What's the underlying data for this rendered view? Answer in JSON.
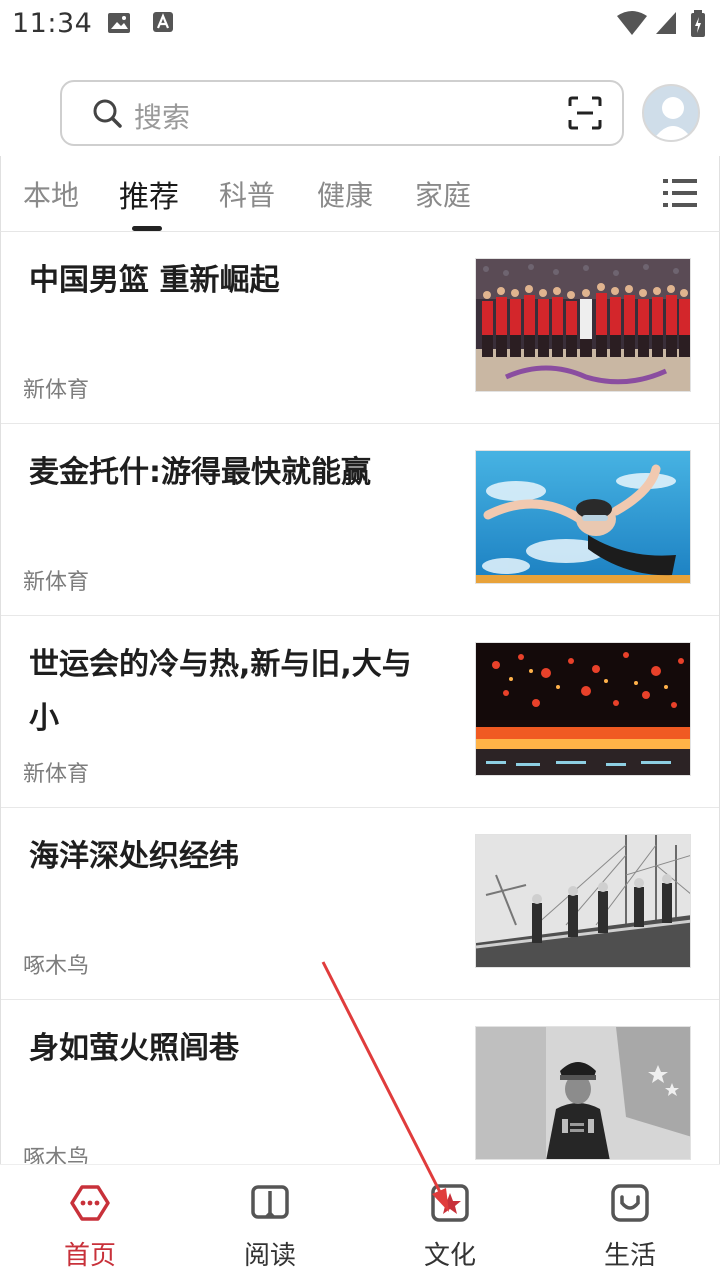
{
  "status_bar": {
    "time": "11:34"
  },
  "search": {
    "placeholder": "搜索"
  },
  "tabs": [
    {
      "label": "本地"
    },
    {
      "label": "推荐",
      "active": true
    },
    {
      "label": "科普"
    },
    {
      "label": "健康"
    },
    {
      "label": "家庭"
    }
  ],
  "feed": [
    {
      "title": "中国男篮 重新崛起",
      "source": "新体育"
    },
    {
      "title": "麦金托什:游得最快就能赢",
      "source": "新体育"
    },
    {
      "title": "世运会的冷与热,新与旧,大与小",
      "source": "新体育"
    },
    {
      "title": "海洋深处织经纬",
      "source": "啄木鸟"
    },
    {
      "title": "身如萤火照闾巷",
      "source": "啄木鸟"
    }
  ],
  "bottom_nav": [
    {
      "label": "首页",
      "icon": "home-icon",
      "active": true
    },
    {
      "label": "阅读",
      "icon": "book-icon"
    },
    {
      "label": "文化",
      "icon": "star-box-icon"
    },
    {
      "label": "生活",
      "icon": "smile-box-icon"
    }
  ],
  "colors": {
    "accent": "#c8313a",
    "annotation_arrow": "#e03c3c"
  }
}
